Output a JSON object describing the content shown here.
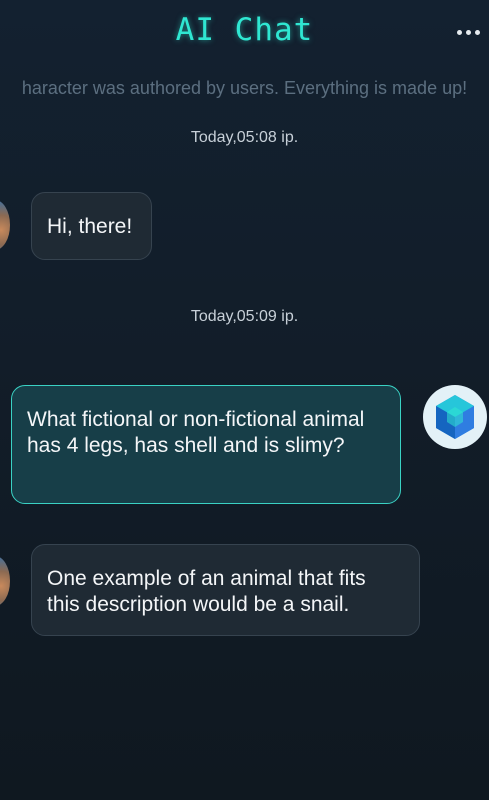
{
  "header": {
    "title": "AI Chat",
    "more_icon": "more-horizontal-icon"
  },
  "disclaimer": "haracter was authored by users. Everything is made up!",
  "messages": [
    {
      "timestamp": "Today,05:08 ip."
    },
    {
      "sender": "bot",
      "text": "Hi, there!"
    },
    {
      "timestamp": "Today,05:09 ip."
    },
    {
      "sender": "user",
      "text": "What fictional or non-fictional animal has 4 legs, has shell and is slimy?"
    },
    {
      "sender": "bot",
      "text": "One example of an animal that fits this description would be a snail."
    }
  ],
  "colors": {
    "accent": "#2fe7d2",
    "background": "#132130",
    "user_bubble": "#173e48",
    "user_bubble_border": "#3ad2c4",
    "bot_bubble": "#1f2a34"
  }
}
